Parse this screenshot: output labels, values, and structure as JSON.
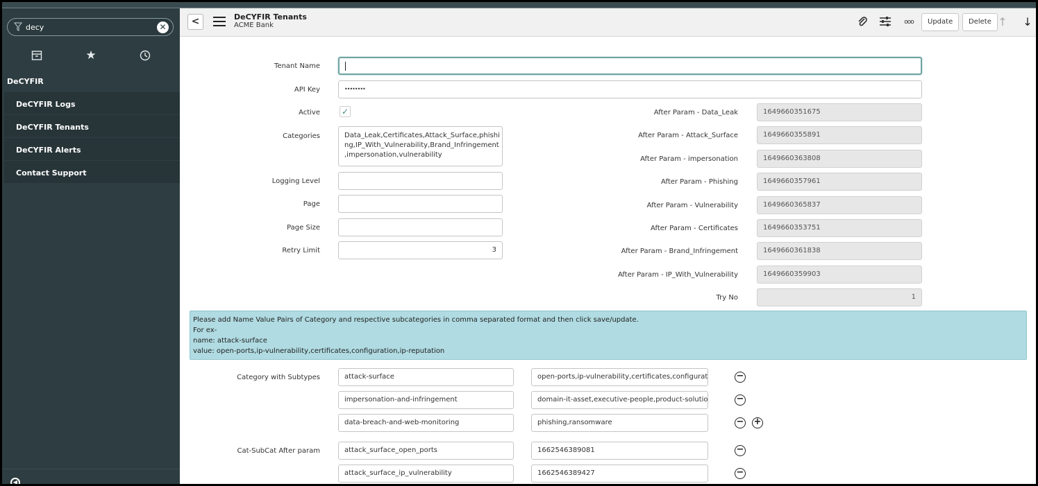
{
  "sidebar": {
    "search_value": "decy",
    "search_icon": "filter-icon",
    "clear_icon": "close-circle-icon",
    "nav_icons": [
      "archive-icon",
      "star-icon",
      "clock-icon"
    ],
    "group_label": "DeCYFIR",
    "items": [
      {
        "label": "DeCYFIR Logs"
      },
      {
        "label": "DeCYFIR Tenants"
      },
      {
        "label": "DeCYFIR Alerts"
      },
      {
        "label": "Contact Support"
      }
    ]
  },
  "header": {
    "title": "DeCYFIR Tenants",
    "subtitle": "ACME Bank",
    "back_glyph": "<",
    "more_glyph": "ooo",
    "update_label": "Update",
    "delete_label": "Delete",
    "up_glyph": "↑",
    "down_glyph": "↓"
  },
  "form": {
    "tenant_name": {
      "label": "Tenant Name",
      "value": ""
    },
    "api_key": {
      "label": "API Key",
      "value": "••••••••"
    },
    "active": {
      "label": "Active",
      "checked": true,
      "check_glyph": "✓"
    },
    "categories": {
      "label": "Categories",
      "lines": [
        "Data_Leak,Certificates,Attack_Surface,phishi",
        "ng,IP_With_Vulnerability,Brand_Infringement",
        ",impersonation,vulnerability"
      ]
    },
    "logging_level": {
      "label": "Logging Level",
      "value": ""
    },
    "page": {
      "label": "Page",
      "value": ""
    },
    "page_size": {
      "label": "Page Size",
      "value": ""
    },
    "retry_limit": {
      "label": "Retry Limit",
      "value": "3"
    },
    "after_params": [
      {
        "label": "After Param - Data_Leak",
        "value": "1649660351675"
      },
      {
        "label": "After Param - Attack_Surface",
        "value": "1649660355891"
      },
      {
        "label": "After Param - impersonation",
        "value": "1649660363808"
      },
      {
        "label": "After Param - Phishing",
        "value": "1649660357961"
      },
      {
        "label": "After Param - Vulnerability",
        "value": "1649660365837"
      },
      {
        "label": "After Param - Certificates",
        "value": "1649660353751"
      },
      {
        "label": "After Param - Brand_Infringement",
        "value": "1649660361838"
      },
      {
        "label": "After Param - IP_With_Vulnerability",
        "value": "1649660359903"
      }
    ],
    "try_no": {
      "label": "Try No",
      "value": "1"
    }
  },
  "info": {
    "lines": [
      "Please add Name Value Pairs of Category and respective subcategories in comma separated format and then click save/update.",
      "For ex-",
      "name: attack-surface",
      "value: open-ports,ip-vulnerability,certificates,configuration,ip-reputation"
    ]
  },
  "category_subtypes": {
    "label": "Category with Subtypes",
    "rows": [
      {
        "name": "attack-surface",
        "value": "open-ports,ip-vulnerability,certificates,configurat"
      },
      {
        "name": "impersonation-and-infringement",
        "value": "domain-it-asset,executive-people,product-solutio"
      },
      {
        "name": "data-breach-and-web-monitoring",
        "value": "phishing,ransomware"
      }
    ]
  },
  "cat_subcat_after": {
    "label": "Cat-SubCat After param",
    "rows": [
      {
        "name": "attack_surface_open_ports",
        "value": "1662546389081"
      },
      {
        "name": "attack_surface_ip_vulnerability",
        "value": "1662546389427"
      }
    ]
  },
  "glyphs": {
    "remove": "−",
    "add": "+"
  },
  "colors": {
    "sidebar_bg": "#2e3d41",
    "menu_item_bg": "#273438",
    "info_bg": "#b0dbe2",
    "focus_border": "#6fa3a0",
    "check_color": "#3b8b82"
  }
}
